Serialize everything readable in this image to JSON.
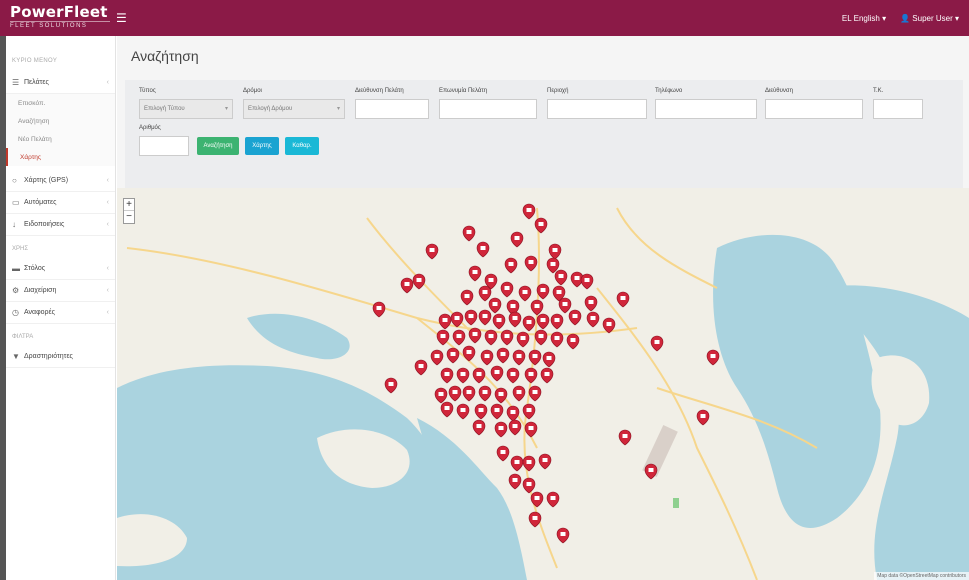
{
  "brand": {
    "name": "PowerFleet",
    "tagline": "FLEET SOLUTIONS"
  },
  "topbar": {
    "menu_label": "☰",
    "lang_label": "EL English ▾",
    "user_label": "👤 Super User ▾"
  },
  "sidebar": {
    "section_main": "ΚΥΡΙΟ ΜΕΝΟΥ",
    "group_label": "Πελάτες",
    "sub_items": [
      "Επισκόπ.",
      "Αναζήτηση",
      "Νέο Πελάτη",
      "Χάρτης"
    ],
    "items_a": [
      {
        "label": "Χάρτης (GPS)",
        "icon": "circle-icon"
      },
      {
        "label": "Αυτόματες",
        "icon": "truck-icon"
      },
      {
        "label": "Ειδοποιήσεις",
        "icon": "pin-icon"
      }
    ],
    "heading_b": "ΧΡΗΣ",
    "items_b": [
      {
        "label": "Στόλος",
        "icon": "car-icon"
      },
      {
        "label": "Διαχείριση",
        "icon": "gear-icon"
      },
      {
        "label": "Αναφορές",
        "icon": "clock-icon"
      }
    ],
    "heading_c": "ΦΙΛΤΡΑ",
    "items_c": [
      {
        "label": "Δραστηριότητες",
        "icon": "filter-icon"
      }
    ]
  },
  "page": {
    "title": "Αναζήτηση"
  },
  "filters": {
    "type_label": "Τύπος",
    "type_value": "Επιλογή Τύπου",
    "brand_label": "Δρόμοι",
    "brand_value": "Επιλογή Δρόμου",
    "street_label": "Διεύθυνση Πελάτη",
    "customer_name_label": "Επωνυμία Πελάτη",
    "region_label": "Περιοχή",
    "phone_label": "Τηλέφωνο",
    "address_label": "Διεύθυνση",
    "zip_label": "Τ.Κ.",
    "extra_label": "Αριθμός",
    "search_button": "Αναζήτηση",
    "map_button": "Χάρτης",
    "clear_button": "Καθαρ."
  },
  "map": {
    "zoom_in": "+",
    "zoom_out": "−",
    "attribution": "Map data ©OpenStreetMap contributors"
  },
  "colors": {
    "topbar": "#8b1a47",
    "marker": "#d0263a",
    "sea": "#aad3df",
    "land": "#f2efe9"
  }
}
